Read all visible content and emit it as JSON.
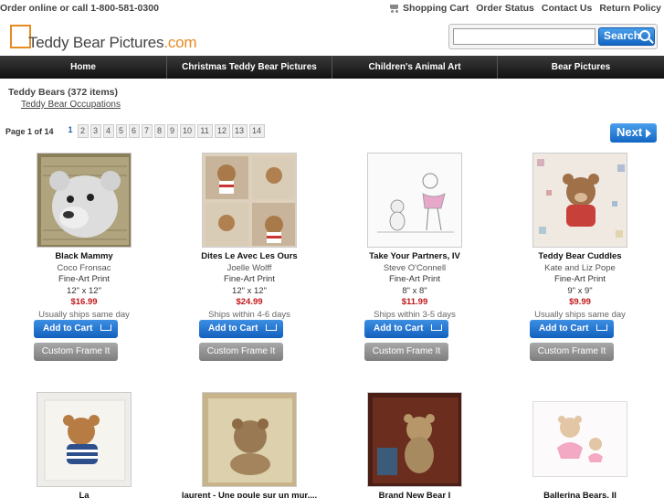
{
  "topbar": {
    "order_text": "Order online or call 1-800-581-0300",
    "links": [
      "Shopping Cart",
      "Order Status",
      "Contact Us",
      "Return Policy"
    ]
  },
  "brand": {
    "name": "Teddy Bear Pictures",
    "tld": ".com",
    "accent": "#e78a22"
  },
  "search": {
    "value": "",
    "button_label": "Search"
  },
  "nav": [
    "Home",
    "Christmas Teddy Bear Pictures",
    "Children's Animal Art",
    "Bear Pictures"
  ],
  "breadcrumb": {
    "title": "Teddy Bears (372 items)",
    "sub": "Teddy Bear Occupations"
  },
  "pager": {
    "label": "Page 1 of 14",
    "pages": [
      "1",
      "2",
      "3",
      "4",
      "5",
      "6",
      "7",
      "8",
      "9",
      "10",
      "11",
      "12",
      "13",
      "14"
    ],
    "next_label": "Next"
  },
  "buttons": {
    "add_to_cart": "Add to Cart",
    "custom_frame": "Custom Frame It"
  },
  "products": [
    {
      "name": "Black Mammy",
      "artist": "Coco Fronsac",
      "type": "Fine-Art Print",
      "size": "12\" x 12\"",
      "price": "$16.99",
      "ship": "Usually ships same day"
    },
    {
      "name": "Dites Le Avec Les Ours",
      "artist": "Joelle Wolff",
      "type": "Fine-Art Print",
      "size": "12\" x 12\"",
      "price": "$24.99",
      "ship": "Ships within 4-6 days"
    },
    {
      "name": "Take Your Partners, IV",
      "artist": "Steve O'Connell",
      "type": "Fine-Art Print",
      "size": "8\" x 8\"",
      "price": "$11.99",
      "ship": "Ships within 3-5 days"
    },
    {
      "name": "Teddy Bear Cuddles",
      "artist": "Kate and Liz Pope",
      "type": "Fine-Art Print",
      "size": "9\" x 9\"",
      "price": "$9.99",
      "ship": "Usually ships same day"
    },
    {
      "name": "La"
    },
    {
      "name": "laurent - Une poule sur un mur...."
    },
    {
      "name": "Brand New Bear I"
    },
    {
      "name": "Ballerina Bears, II"
    }
  ],
  "colors": {
    "price": "#c0181a",
    "button_blue": "#1a6fd0",
    "nav_dark": "#1a1a1a"
  }
}
